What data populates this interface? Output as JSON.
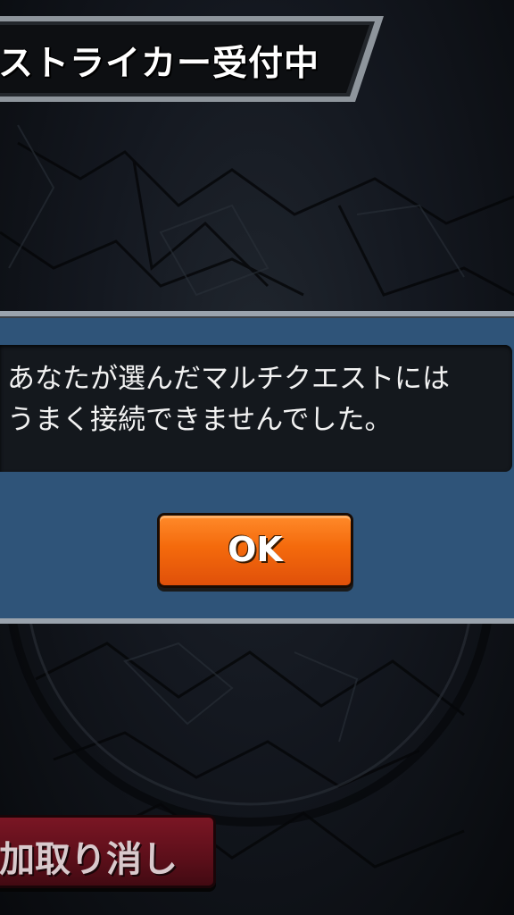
{
  "header": {
    "title": "ストライカー受付中"
  },
  "dialog": {
    "message_line1": "あなたが選んだマルチクエストには",
    "message_line2": "うまく接続できませんでした。",
    "ok_label": "OK"
  },
  "footer": {
    "cancel_label": "加取り消し"
  },
  "colors": {
    "dialog_panel": "#2f5479",
    "ok_button": "#f46a0c",
    "cancel_button": "#5c0f1a",
    "background": "#0c0f13"
  }
}
